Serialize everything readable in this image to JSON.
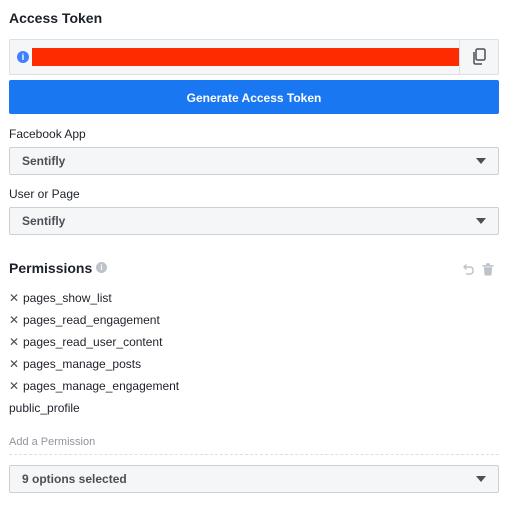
{
  "access_token": {
    "title": "Access Token",
    "info_icon": "info-icon",
    "value": "",
    "copy_icon": "copy-icon",
    "generate_label": "Generate Access Token"
  },
  "facebook_app": {
    "label": "Facebook App",
    "selected": "Sentifly"
  },
  "user_or_page": {
    "label": "User or Page",
    "selected": "Sentifly"
  },
  "permissions": {
    "title": "Permissions",
    "items": [
      {
        "label": "pages_show_list",
        "removable": true
      },
      {
        "label": "pages_read_engagement",
        "removable": true
      },
      {
        "label": "pages_read_user_content",
        "removable": true
      },
      {
        "label": "pages_manage_posts",
        "removable": true
      },
      {
        "label": "pages_manage_engagement",
        "removable": true
      },
      {
        "label": "public_profile",
        "removable": false
      }
    ],
    "add_placeholder": "Add a Permission",
    "options_selected": "9 options selected"
  },
  "colors": {
    "primary_button": "#1a77f2",
    "redaction": "#fe2a00",
    "info": "#4080ff"
  }
}
